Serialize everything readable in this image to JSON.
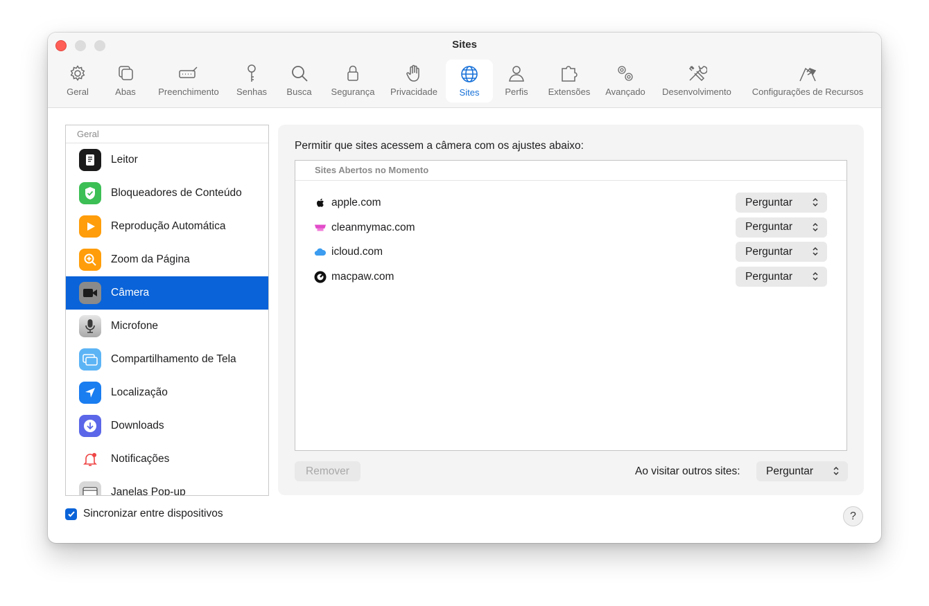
{
  "window": {
    "title": "Sites"
  },
  "toolbar": {
    "items": [
      {
        "label": "Geral",
        "icon": "gear-icon"
      },
      {
        "label": "Abas",
        "icon": "tabs-icon"
      },
      {
        "label": "Preenchimento",
        "icon": "autofill-icon"
      },
      {
        "label": "Senhas",
        "icon": "key-icon"
      },
      {
        "label": "Busca",
        "icon": "search-icon"
      },
      {
        "label": "Segurança",
        "icon": "lock-icon"
      },
      {
        "label": "Privacidade",
        "icon": "hand-icon"
      },
      {
        "label": "Sites",
        "icon": "globe-icon",
        "selected": true
      },
      {
        "label": "Perfis",
        "icon": "person-icon"
      },
      {
        "label": "Extensões",
        "icon": "puzzle-icon"
      },
      {
        "label": "Avançado",
        "icon": "gears-icon"
      },
      {
        "label": "Desenvolvimento",
        "icon": "tools-icon"
      },
      {
        "label": "Configurações de Recursos",
        "icon": "flags-icon"
      }
    ],
    "accent_color": "#1670d8"
  },
  "sidebar": {
    "header": "Geral",
    "items": [
      {
        "label": "Leitor",
        "icon": "reader-icon"
      },
      {
        "label": "Bloqueadores de Conteúdo",
        "icon": "shield-check-icon"
      },
      {
        "label": "Reprodução Automática",
        "icon": "play-icon"
      },
      {
        "label": "Zoom da Página",
        "icon": "zoom-icon"
      },
      {
        "label": "Câmera",
        "icon": "camera-icon",
        "selected": true
      },
      {
        "label": "Microfone",
        "icon": "microphone-icon"
      },
      {
        "label": "Compartilhamento de Tela",
        "icon": "screen-share-icon"
      },
      {
        "label": "Localização",
        "icon": "location-icon"
      },
      {
        "label": "Downloads",
        "icon": "download-icon"
      },
      {
        "label": "Notificações",
        "icon": "bell-icon"
      },
      {
        "label": "Janelas Pop-up",
        "icon": "popup-window-icon"
      }
    ],
    "selection_color": "#0a63d8"
  },
  "panel": {
    "description": "Permitir que sites acessem a câmera com os ajustes abaixo:",
    "table_header": "Sites Abertos no Momento",
    "sites": [
      {
        "domain": "apple.com",
        "setting": "Perguntar",
        "icon": "apple-logo-icon"
      },
      {
        "domain": "cleanmymac.com",
        "setting": "Perguntar",
        "icon": "cleanmymac-icon"
      },
      {
        "domain": "icloud.com",
        "setting": "Perguntar",
        "icon": "icloud-icon"
      },
      {
        "domain": "macpaw.com",
        "setting": "Perguntar",
        "icon": "macpaw-icon"
      }
    ],
    "remove_label": "Remover",
    "other_sites_label": "Ao visitar outros sites:",
    "other_sites_value": "Perguntar"
  },
  "footer": {
    "sync_label": "Sincronizar entre dispositivos",
    "sync_checked": true,
    "help_label": "?"
  }
}
